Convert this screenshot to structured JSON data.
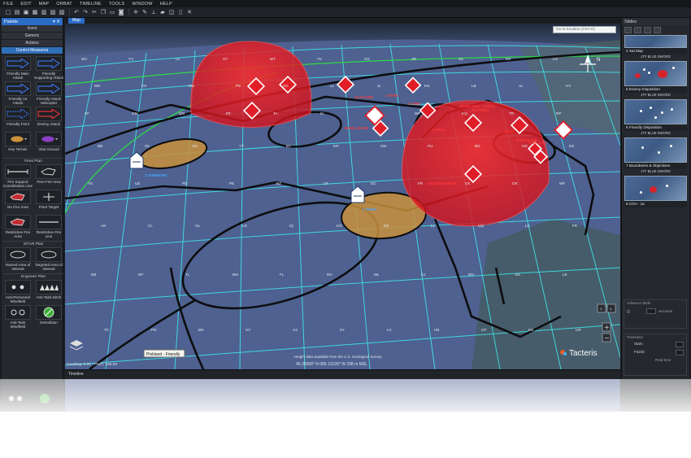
{
  "menu": [
    "FILE",
    "EDIT",
    "MAP",
    "ORBAT",
    "TIMELINE",
    "TOOLS",
    "WINDOW",
    "HELP"
  ],
  "toolbar_icons": [
    "new-icon",
    "open-icon",
    "save-icon",
    "save-as-icon",
    "print-icon",
    "export-icon",
    "import-icon",
    "undo-icon",
    "redo-icon",
    "cut-icon",
    "copy-icon",
    "paste-icon",
    "camera-icon",
    "move-icon",
    "draw-icon",
    "measure-icon",
    "layer-icon",
    "zoom-icon",
    "fullscreen-icon",
    "close-icon"
  ],
  "palette": {
    "title": "Palette",
    "tabs": [
      "Icons",
      "Generic",
      "Actions",
      "Control Measures"
    ],
    "active_tab": "Control Measures",
    "items_top": [
      {
        "label": "Friendly Main Attack",
        "icon": "main-attack-arrow-icon"
      },
      {
        "label": "Friendly Supporting Attack",
        "icon": "supporting-attack-arrow-icon"
      },
      {
        "label": "Friendly Air Attack",
        "icon": "air-attack-arrow-icon"
      },
      {
        "label": "Friendly Attack Helicopter",
        "icon": "helicopter-attack-arrow-icon"
      },
      {
        "label": "Friendly Feint",
        "icon": "feint-arrow-icon"
      },
      {
        "label": "Enemy Attack",
        "icon": "enemy-attack-arrow-icon"
      },
      {
        "label": "Key Terrain",
        "icon": "key-terrain-icon"
      },
      {
        "label": "Vital Ground",
        "icon": "vital-ground-icon"
      }
    ],
    "section_fires": "Fires Plan",
    "items_fires": [
      {
        "label": "Fire Support Coordination Line",
        "icon": "fscl-icon"
      },
      {
        "label": "Free Fire Area",
        "icon": "free-fire-area-icon"
      },
      {
        "label": "No Fire Area",
        "icon": "no-fire-area-icon"
      },
      {
        "label": "Point Target",
        "icon": "point-target-icon"
      },
      {
        "label": "Restrictive Fire Area",
        "icon": "restrictive-fire-area-icon"
      },
      {
        "label": "Restrictive Fire Line",
        "icon": "restrictive-fire-line-icon"
      }
    ],
    "section_istar": "ISTAR Plan",
    "items_istar": [
      {
        "label": "Named Area of Interest",
        "icon": "nai-icon"
      },
      {
        "label": "Targeted Area of Interest",
        "icon": "tai-icon"
      }
    ],
    "section_engineer": "Engineer Plan",
    "items_engineer": [
      {
        "label": "Anti-Personnel Minefield",
        "icon": "ap-minefield-icon"
      },
      {
        "label": "Anti-Tank Ditch",
        "icon": "at-ditch-icon"
      },
      {
        "label": "Anti-Tank Minefield",
        "icon": "at-minefield-icon"
      },
      {
        "label": "Demolition",
        "icon": "demolition-icon"
      }
    ]
  },
  "map": {
    "tab": "Map",
    "search_placeholder": "Go to location (Ctrl+G)",
    "status_left": "Heading: 0.00 - Pitch: 168.00",
    "status_attribution": "Height data available from the U.S. Geological Survey",
    "status_coords": "49.30068° N  086.13109° W  298 m MSL",
    "tooltip": "Pinkland - Friendly",
    "brand": "Tacteris",
    "compass": "N",
    "grid_labels": [
      "WV",
      "YV",
      "LV",
      "XY",
      "WT",
      "YK",
      "HG",
      "ZD",
      "ZS",
      "KR",
      "LO",
      "WE",
      "KS",
      "MU",
      "PS",
      "SD",
      "LL",
      "JL",
      "KN",
      "LB",
      "AL",
      "HV",
      "VF",
      "OM",
      "QN",
      "RT",
      "TA",
      "KI",
      "AY",
      "WP",
      "KQ",
      "TR",
      "RP",
      "BB",
      "ZS",
      "UN",
      "YT",
      "BY",
      "KR",
      "UM",
      "PU",
      "BD",
      "HD",
      "DS",
      "YE",
      "UE",
      "PD",
      "PE",
      "BZ",
      "UF",
      "DC",
      "FR",
      "CK",
      "OK",
      "WF",
      "AN",
      "CL",
      "OL",
      "LD",
      "IQ",
      "KO",
      "EB",
      "LL",
      "UQ",
      "LC",
      "FR",
      "DB",
      "NP",
      "TL",
      "BM",
      "FL",
      "DH",
      "ML",
      "KJ",
      "DN",
      "EK",
      "LE",
      "TC",
      "PN",
      "BN",
      "XV",
      "AX",
      "ZY",
      "LX",
      "HB",
      "CP",
      "MJ",
      "UR",
      "BV",
      "CQ",
      "TD",
      "YK",
      "RX",
      "LU",
      "JK",
      "DQ",
      "RT",
      "BB",
      "KT",
      "JP",
      "BA",
      "LZ"
    ],
    "unit_labels": [
      "3 SUBRIGHT",
      "2 SWAP",
      "AZ FLANK",
      "1-4 BN",
      "NAVAL BASE",
      "1 TAKE",
      "PINKLAND - Enemy",
      "6 BRIG",
      "HQ SQUADRON",
      "SUPPORT",
      "13 PZ",
      "BATTALION",
      "3 OR 1 SQ"
    ]
  },
  "timeline": {
    "tab": "Timeline"
  },
  "slides": {
    "title": "Slides",
    "items": [
      {
        "num": "4",
        "caption": "Sat Map",
        "sub": "JTF BLUE SWORD"
      },
      {
        "num": "5",
        "caption": "Enemy Disposition",
        "sub": "JTF BLUE SWORD"
      },
      {
        "num": "6",
        "caption": "Friendly Disposition",
        "sub": "JTF BLUE SWORD"
      },
      {
        "num": "7",
        "caption": "Boundaries & Objectives",
        "sub": "JTF BLUE SWORD"
      },
      {
        "num": "8",
        "caption": "COA - 1a",
        "sub": ""
      }
    ],
    "advance_group": "Advance Slide",
    "seconds_label": "seconds",
    "transition_group": "Transition",
    "start_label": "Start:",
    "finish_label": "Finish:",
    "realtime_label": "Real time"
  },
  "colors": {
    "accent": "#2b6cc4",
    "map_bg": "#4c5f8a",
    "grid": "#3fe3e8",
    "enemy": "#e11e28",
    "friendly_area": "#c9903c"
  }
}
